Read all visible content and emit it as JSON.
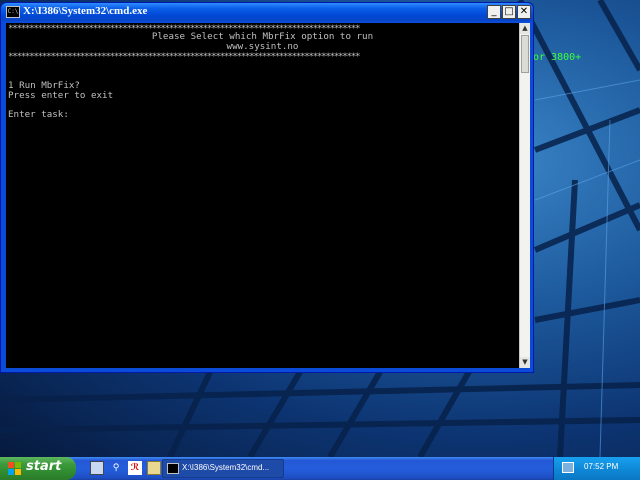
{
  "desktop": {
    "partial_text": "or 3800+"
  },
  "window": {
    "title": "X:\\I386\\System32\\cmd.exe",
    "icon_text": "C:\\",
    "buttons": {
      "minimize": "_",
      "maximize": "□",
      "close": "✕"
    }
  },
  "console": {
    "stars": "***********************************************************************************",
    "heading": "Please Select which MbrFix option to run",
    "url": "www.sysint.no",
    "option_1": "1 Run MbrFix?",
    "exit_hint": "Press enter to exit",
    "prompt": "Enter task:"
  },
  "taskbar": {
    "start_label": "start",
    "task_item_label": "X:\\I386\\System32\\cmd...",
    "clock": "07:52 PM"
  },
  "colors": {
    "console_bg": "#000000",
    "console_text": "#c0c0c0",
    "title_bar": "#0a5ee8",
    "taskbar": "#245edc",
    "start_button": "#3c9a3c"
  }
}
